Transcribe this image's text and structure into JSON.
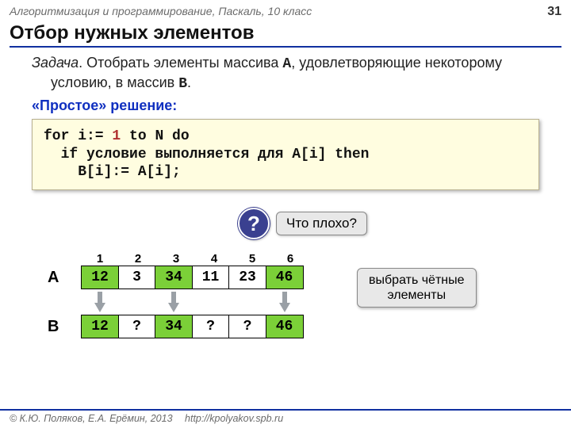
{
  "header": {
    "course": "Алгоритмизация и программирование, Паскаль, 10 класс",
    "page": "31"
  },
  "title": "Отбор нужных элементов",
  "task": {
    "label": "Задача",
    "text_before": ". Отобрать элементы массива ",
    "arrA": "A",
    "text_mid": ", удовлетворяющие некоторому условию, в массив ",
    "arrB": "B",
    "text_after": "."
  },
  "subheading": "«Простое» решение:",
  "code": {
    "l1a": "for i:= ",
    "l1num": "1",
    "l1b": " to N do",
    "l2": "  if условие выполняется для A[i] then",
    "l3": "    B[i]:= A[i];"
  },
  "callout": {
    "q": "?",
    "text": "Что плохо?"
  },
  "arrays": {
    "indices": [
      "1",
      "2",
      "3",
      "4",
      "5",
      "6"
    ],
    "A": {
      "name": "A",
      "cells": [
        {
          "v": "12",
          "c": "green"
        },
        {
          "v": "3",
          "c": "plain"
        },
        {
          "v": "34",
          "c": "green"
        },
        {
          "v": "11",
          "c": "plain"
        },
        {
          "v": "23",
          "c": "plain"
        },
        {
          "v": "46",
          "c": "green"
        }
      ]
    },
    "arrows": [
      true,
      false,
      true,
      false,
      false,
      true
    ],
    "B": {
      "name": "B",
      "cells": [
        {
          "v": "12",
          "c": "green"
        },
        {
          "v": "?",
          "c": "plain"
        },
        {
          "v": "34",
          "c": "green"
        },
        {
          "v": "?",
          "c": "plain"
        },
        {
          "v": "?",
          "c": "plain"
        },
        {
          "v": "46",
          "c": "green"
        }
      ]
    }
  },
  "right_callout": {
    "l1": "выбрать чётные",
    "l2": "элементы"
  },
  "footer": {
    "copyright": "© К.Ю. Поляков, Е.А. Ерёмин, 2013",
    "url": "http://kpolyakov.spb.ru"
  }
}
